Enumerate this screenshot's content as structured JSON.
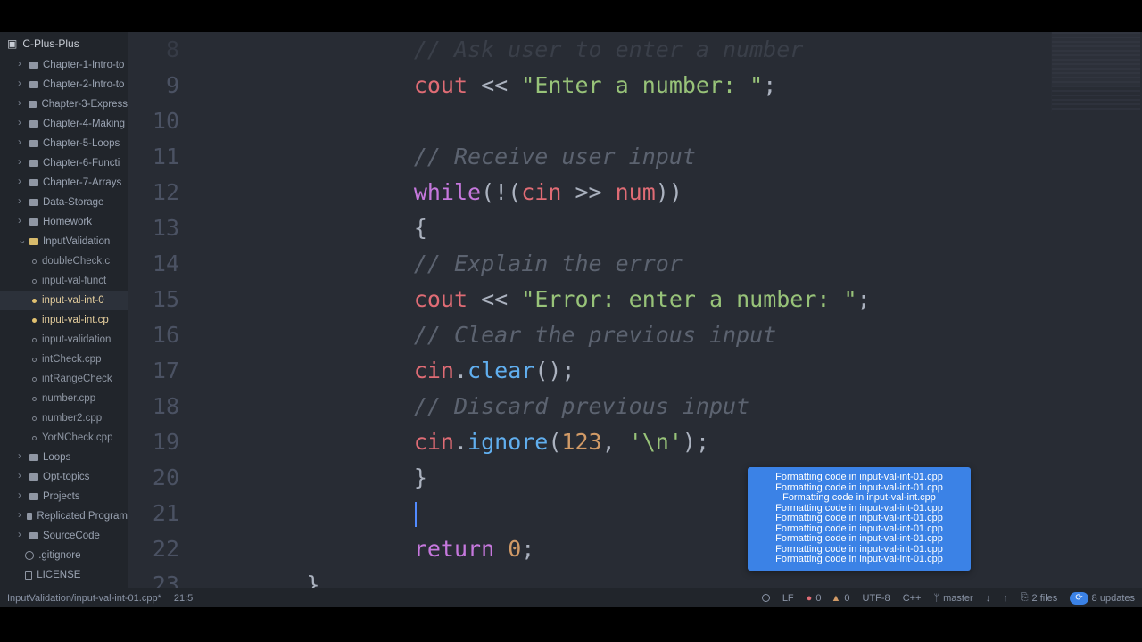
{
  "project": {
    "name": "C-Plus-Plus"
  },
  "tree": {
    "folders": [
      "Chapter-1-Intro-to",
      "Chapter-2-Intro-to",
      "Chapter-3-Express",
      "Chapter-4-Making",
      "Chapter-5-Loops",
      "Chapter-6-Functi",
      "Chapter-7-Arrays",
      "Data-Storage",
      "Homework"
    ],
    "open_folder": "InputValidation",
    "files": [
      {
        "name": "doubleCheck.c",
        "modified": false
      },
      {
        "name": "input-val-funct",
        "modified": false
      },
      {
        "name": "input-val-int-0",
        "modified": true,
        "active": true
      },
      {
        "name": "input-val-int.cp",
        "modified": true
      },
      {
        "name": "input-validation",
        "modified": false
      },
      {
        "name": "intCheck.cpp",
        "modified": false
      },
      {
        "name": "intRangeCheck",
        "modified": false
      },
      {
        "name": "number.cpp",
        "modified": false
      },
      {
        "name": "number2.cpp",
        "modified": false
      },
      {
        "name": "YorNCheck.cpp",
        "modified": false
      }
    ],
    "folders_after": [
      "Loops",
      "Opt-topics",
      "Projects",
      "Replicated Program",
      "SourceCode"
    ],
    "extra_files": [
      {
        "name": ".gitignore",
        "icon": "git"
      },
      {
        "name": "LICENSE",
        "icon": "license"
      }
    ]
  },
  "code": {
    "first_line": 8,
    "lines": [
      {
        "indent": 2,
        "tokens": [
          [
            "cm",
            "// Ask user to enter a number"
          ]
        ],
        "faded": true
      },
      {
        "indent": 2,
        "tokens": [
          [
            "id",
            "cout"
          ],
          [
            "op",
            " << "
          ],
          [
            "str",
            "\"Enter a number: \""
          ],
          [
            "pn",
            ";"
          ]
        ]
      },
      {
        "indent": 0,
        "tokens": []
      },
      {
        "indent": 2,
        "tokens": [
          [
            "cm",
            "// Receive user input"
          ]
        ]
      },
      {
        "indent": 2,
        "tokens": [
          [
            "kw",
            "while"
          ],
          [
            "pn",
            "(!("
          ],
          [
            "id",
            "cin"
          ],
          [
            "op",
            " >> "
          ],
          [
            "id",
            "num"
          ],
          [
            "pn",
            "))"
          ]
        ]
      },
      {
        "indent": 2,
        "tokens": [
          [
            "pn",
            "{"
          ]
        ]
      },
      {
        "indent": 4,
        "tokens": [
          [
            "cm",
            "// Explain the error"
          ]
        ]
      },
      {
        "indent": 4,
        "tokens": [
          [
            "id",
            "cout"
          ],
          [
            "op",
            " << "
          ],
          [
            "str",
            "\"Error: enter a number: \""
          ],
          [
            "pn",
            ";"
          ]
        ]
      },
      {
        "indent": 4,
        "tokens": [
          [
            "cm",
            "// Clear the previous input"
          ]
        ]
      },
      {
        "indent": 4,
        "tokens": [
          [
            "id",
            "cin"
          ],
          [
            "pn",
            "."
          ],
          [
            "fn",
            "clear"
          ],
          [
            "pn",
            "();"
          ]
        ]
      },
      {
        "indent": 4,
        "tokens": [
          [
            "cm",
            "// Discard previous input"
          ]
        ]
      },
      {
        "indent": 4,
        "tokens": [
          [
            "id",
            "cin"
          ],
          [
            "pn",
            "."
          ],
          [
            "fn",
            "ignore"
          ],
          [
            "pn",
            "("
          ],
          [
            "num",
            "123"
          ],
          [
            "pn",
            ", "
          ],
          [
            "str",
            "'\\n'"
          ],
          [
            "pn",
            ");"
          ]
        ]
      },
      {
        "indent": 2,
        "tokens": [
          [
            "pn",
            "}"
          ]
        ]
      },
      {
        "indent": 2,
        "tokens": [],
        "cursor": true
      },
      {
        "indent": 2,
        "tokens": [
          [
            "kw",
            "return"
          ],
          [
            "op",
            " "
          ],
          [
            "num",
            "0"
          ],
          [
            "pn",
            ";"
          ]
        ]
      },
      {
        "indent": 0,
        "tokens": [
          [
            "pn",
            "}"
          ]
        ]
      }
    ]
  },
  "popup_lines": [
    "Formatting code in input-val-int-01.cpp",
    "Formatting code in input-val-int-01.cpp",
    "Formatting code in input-val-int.cpp",
    "Formatting code in input-val-int-01.cpp",
    "Formatting code in input-val-int-01.cpp",
    "Formatting code in input-val-int-01.cpp",
    "Formatting code in input-val-int-01.cpp",
    "Formatting code in input-val-int-01.cpp",
    "Formatting code in input-val-int-01.cpp"
  ],
  "status": {
    "path": "InputValidation/input-val-int-01.cpp*",
    "cursor": "21:5",
    "line_ending": "LF",
    "errors": "0",
    "warnings": "0",
    "encoding": "UTF-8",
    "language": "C++",
    "branch": "master",
    "fetch_icon": "↓",
    "push_icon": "↑",
    "files_label": "2 files",
    "updates_label": "8 updates"
  }
}
